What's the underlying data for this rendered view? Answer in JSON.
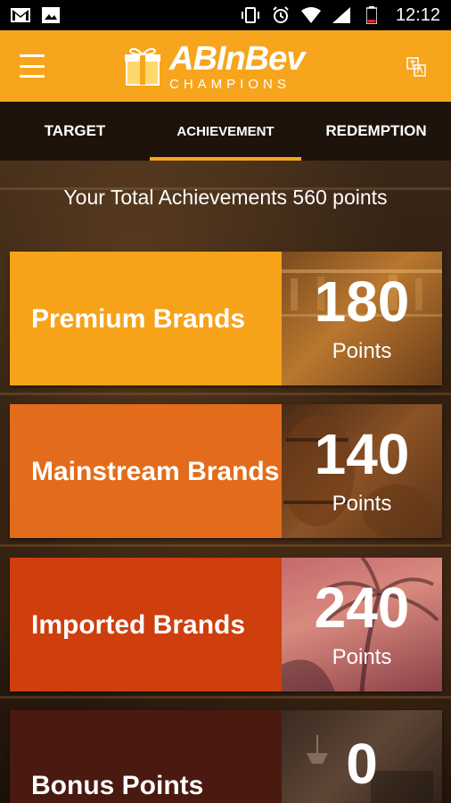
{
  "status_bar": {
    "time": "12:12",
    "left_icons": [
      "gmail-icon",
      "image-icon"
    ],
    "right_icons": [
      "vibrate-icon",
      "alarm-icon",
      "wifi-icon",
      "signal-icon",
      "battery-icon"
    ]
  },
  "app_bar": {
    "menu_icon": "hamburger-menu-icon",
    "logo": {
      "brand": "ABInBev",
      "sub": "CHAMPIONS"
    },
    "language_icon": "translate-icon"
  },
  "tabs": [
    {
      "label": "TARGET",
      "active": false
    },
    {
      "label": "ACHIEVEMENT",
      "active": true
    },
    {
      "label": "REDEMPTION",
      "active": false
    }
  ],
  "total": {
    "text": "Your Total Achievements 560 points"
  },
  "cards": [
    {
      "title": "Premium Brands",
      "points": "180",
      "points_label": "Points",
      "color": "#f6a31a"
    },
    {
      "title": "Mainstream Brands",
      "points": "140",
      "points_label": "Points",
      "color": "#e26c1b"
    },
    {
      "title": "Imported Brands",
      "points": "240",
      "points_label": "Points",
      "color": "#cf3e0d"
    },
    {
      "title": "Bonus Points",
      "points": "0",
      "points_label": "",
      "color": "#4a1a10"
    }
  ],
  "colors": {
    "accent": "#f7a51c",
    "status_bar": "#000000"
  }
}
